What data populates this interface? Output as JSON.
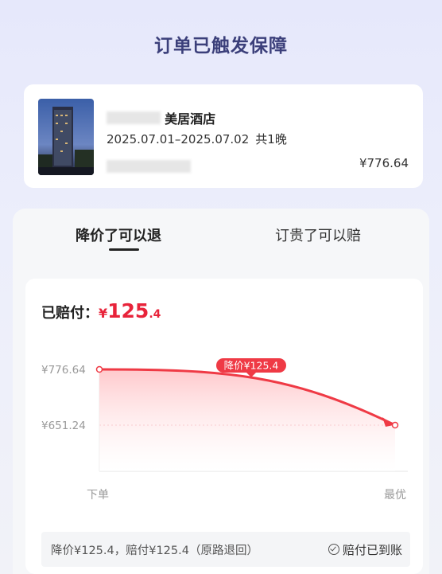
{
  "header": {
    "title": "订单已触发保障"
  },
  "hotel": {
    "name_visible": "美居酒店",
    "dates": "2025.07.01–2025.07.02",
    "nights": "共1晚",
    "price": "¥776.64"
  },
  "tabs": [
    {
      "label": "降价了可以退",
      "active": true
    },
    {
      "label": "订贵了可以赔",
      "active": false
    }
  ],
  "paid": {
    "label": "已赔付：",
    "currency": "¥",
    "amount_int": "125",
    "amount_dec": ".4"
  },
  "chart_data": {
    "type": "area",
    "x": [
      "下单",
      "最优"
    ],
    "y_ticks": [
      "¥776.64",
      "¥651.24"
    ],
    "values": [
      776.64,
      651.24
    ],
    "annotation": "降价¥125.4",
    "colors": {
      "line": "#ef3a45",
      "fill_top": "#ffd6d8",
      "fill_bottom": "#ffffff"
    }
  },
  "footer": {
    "text": "降价¥125.4，赔付¥125.4（原路退回）",
    "status": "赔付已到账",
    "status_icon": "check-circle-icon"
  }
}
